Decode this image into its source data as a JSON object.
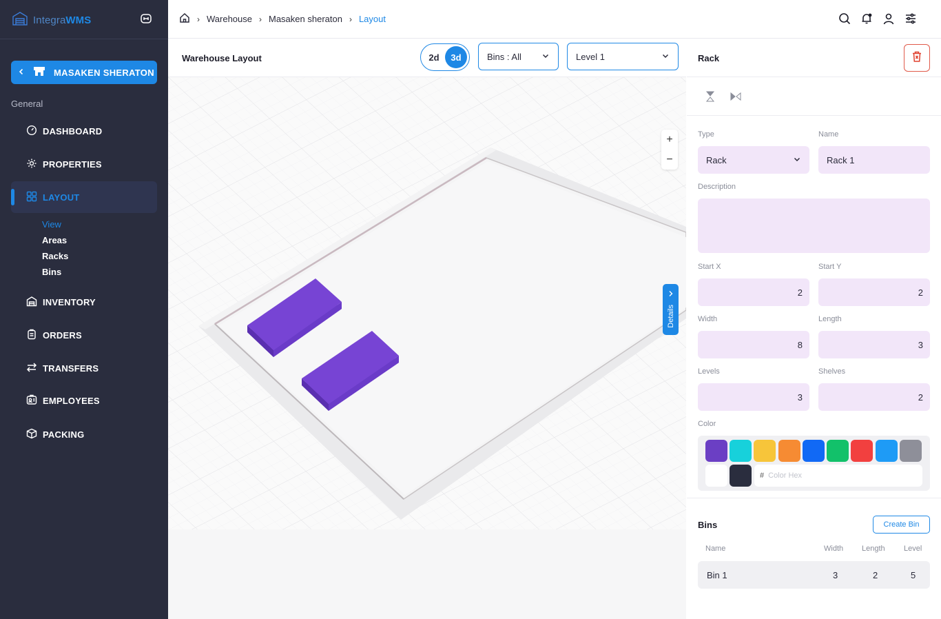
{
  "brand": {
    "name_part1": "Integra",
    "name_part2": "WMS"
  },
  "sidebar": {
    "project": "MASAKEN SHERATON",
    "section": "General",
    "items": [
      {
        "label": "DASHBOARD",
        "icon": "dashboard-icon"
      },
      {
        "label": "PROPERTIES",
        "icon": "gear-icon"
      },
      {
        "label": "LAYOUT",
        "icon": "layout-icon",
        "active": true
      },
      {
        "label": "INVENTORY",
        "icon": "warehouse-icon"
      },
      {
        "label": "ORDERS",
        "icon": "clipboard-icon"
      },
      {
        "label": "TRANSFERS",
        "icon": "transfer-icon"
      },
      {
        "label": "EMPLOYEES",
        "icon": "id-card-icon"
      },
      {
        "label": "PACKING",
        "icon": "box-icon"
      }
    ],
    "sub_items": [
      "View",
      "Areas",
      "Racks",
      "Bins"
    ]
  },
  "breadcrumb": [
    "Warehouse",
    "Masaken sheraton",
    "Layout"
  ],
  "main": {
    "title": "Warehouse Layout",
    "toggle": {
      "opt1": "2d",
      "opt2": "3d",
      "active": "3d"
    },
    "bins_select": "Bins : All",
    "level_select": "Level 1",
    "zoom_in": "+",
    "zoom_out": "−",
    "details_tab": "Details"
  },
  "panel": {
    "title": "Rack",
    "type_label": "Type",
    "type_value": "Rack",
    "name_label": "Name",
    "name_value": "Rack 1",
    "description_label": "Description",
    "description_value": "",
    "start_x_label": "Start X",
    "start_x": "2",
    "start_y_label": "Start Y",
    "start_y": "2",
    "width_label": "Width",
    "width": "8",
    "length_label": "Length",
    "length": "3",
    "levels_label": "Levels",
    "levels": "3",
    "shelves_label": "Shelves",
    "shelves": "2",
    "color_label": "Color",
    "colors": [
      "#6b3fc4",
      "#17d1db",
      "#f7c53a",
      "#f68b33",
      "#1169f5",
      "#12c16a",
      "#f2403f",
      "#1e9bf6",
      "#8e8f99",
      "#ffffff",
      "#2a2d3e"
    ],
    "selected_color": "#6b3fc4",
    "hex_prefix": "#",
    "hex_placeholder": "Color Hex",
    "bins_title": "Bins",
    "create_bin": "Create Bin",
    "bins_columns": [
      "Name",
      "Width",
      "Length",
      "Level"
    ],
    "bins_rows": [
      {
        "name": "Bin 1",
        "width": "3",
        "length": "2",
        "level": "5"
      }
    ]
  }
}
